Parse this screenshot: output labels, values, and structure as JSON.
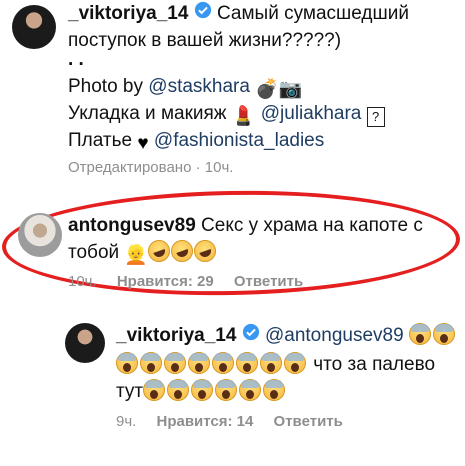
{
  "post": {
    "username": "_viktoriya_14",
    "caption_line1": "Самый сумасшедший",
    "caption_line2": "поступок в вашей жизни?????)",
    "dots": ". .",
    "photo_prefix": "Photo by ",
    "photo_mention": "@staskhara",
    "makeup_prefix": "Укладка и макияж",
    "makeup_mention": "@juliakhara",
    "dress_prefix": "Платье",
    "dress_mention": "@fashionista_ladies",
    "edited_label": "Отредактировано",
    "time": "10ч."
  },
  "comment": {
    "username": "antongusev89",
    "text_line1": "Секс у храма на капоте с",
    "text_line2": "тобой",
    "time": "10ч.",
    "likes_label": "Нравится: 29",
    "reply_label": "Ответить"
  },
  "reply": {
    "username": "_viktoriya_14",
    "mention": "@antongusev89",
    "text_mid": "что за палево",
    "text_end": "тут",
    "time": "9ч.",
    "likes_label": "Нравится: 14",
    "reply_label": "Ответить"
  },
  "colors": {
    "highlight": "#e51f1f",
    "mention": "#1f3d63",
    "meta": "#8e8e8e",
    "verified": "#3897f0"
  },
  "icons": [
    "verified-badge-icon",
    "bomb-emoji",
    "camera-emoji",
    "lipstick-emoji",
    "question-box-icon",
    "black-heart-emoji",
    "scream-emoji",
    "rofl-emoji",
    "woman-emoji"
  ]
}
